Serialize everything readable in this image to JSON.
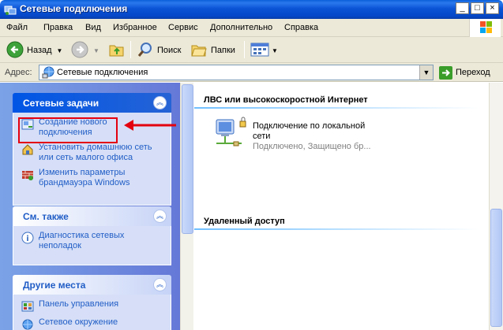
{
  "window": {
    "title": "Сетевые подключения",
    "minimize": "_",
    "maximize": "□",
    "close": "×"
  },
  "menu": [
    "Файл",
    "Правка",
    "Вид",
    "Избранное",
    "Сервис",
    "Дополнительно",
    "Справка"
  ],
  "toolbar": {
    "back_label": "Назад",
    "search_label": "Поиск",
    "folders_label": "Папки"
  },
  "address": {
    "label": "Адрес:",
    "value": "Сетевые подключения",
    "go_label": "Переход"
  },
  "left_panels": {
    "network_tasks": {
      "title": "Сетевые задачи",
      "items": [
        "Создание нового подключения",
        "Установить домашнюю сеть или сеть малого офиса",
        "Изменить параметры брандмауэра Windows"
      ]
    },
    "see_also": {
      "title": "См. также",
      "items": [
        "Диагностика сетевых неполадок"
      ]
    },
    "other_places": {
      "title": "Другие места",
      "items": [
        "Панель управления",
        "Сетевое окружение"
      ]
    }
  },
  "main": {
    "lan_group": "ЛВС или высокоскоростной Интернет",
    "connection": {
      "name_line1": "Подключение по локальной",
      "name_line2": "сети",
      "status": "Подключено, Защищено бр..."
    },
    "remote_group": "Удаленный доступ"
  },
  "colors": {
    "titlebar": "#0a54d6",
    "task_link": "#215dc6",
    "highlight": "#e4000f",
    "pane_gradient_left": "#7ba2e7",
    "pane_gradient_right": "#6375d6"
  }
}
